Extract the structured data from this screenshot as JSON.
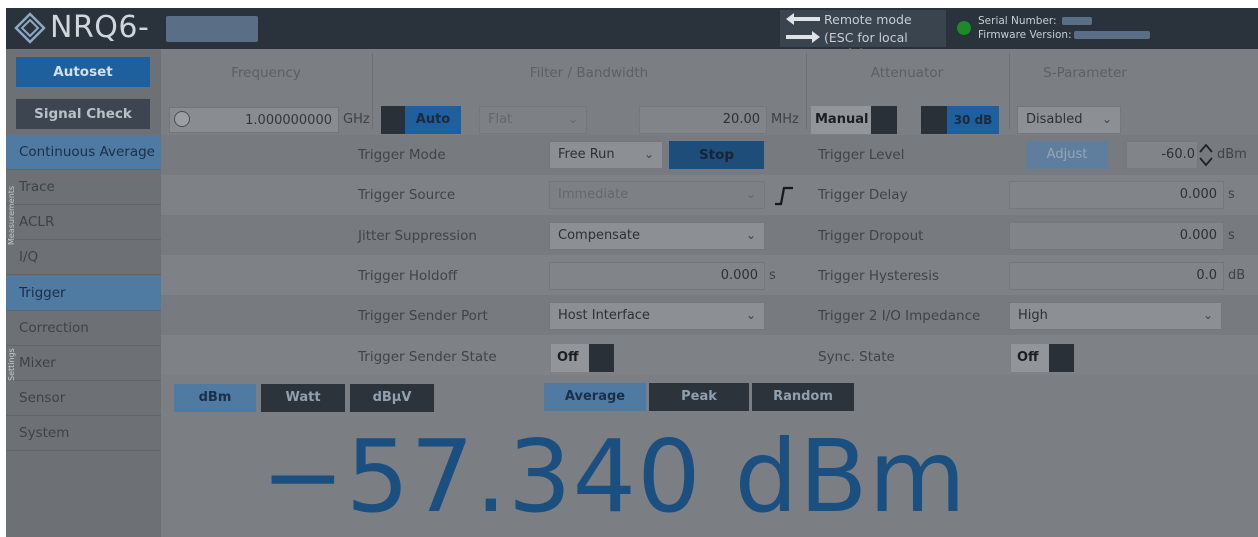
{
  "header": {
    "title": "NRQ6-",
    "remote_line1": "Remote mode",
    "remote_line2": "(ESC for local mode)",
    "serial_label": "Serial Number:",
    "firmware_label": "Firmware Version:",
    "status_color": "#1c8a2a"
  },
  "nav": {
    "autoset": "Autoset",
    "signal_check": "Signal Check",
    "group_measurements": "Measurements",
    "group_settings": "Settings",
    "items": [
      {
        "label": "Continuous Average",
        "selected": true
      },
      {
        "label": "Trace",
        "selected": false
      },
      {
        "label": "ACLR",
        "selected": false
      },
      {
        "label": "I/Q",
        "selected": false
      },
      {
        "label": "Trigger",
        "selected": true
      },
      {
        "label": "Correction",
        "selected": false
      },
      {
        "label": "Mixer",
        "selected": false
      },
      {
        "label": "Sensor",
        "selected": false
      },
      {
        "label": "System",
        "selected": false
      }
    ]
  },
  "topbar": {
    "frequency": {
      "title": "Frequency",
      "value": "1.000000000",
      "unit": "GHz"
    },
    "filter": {
      "title": "Filter / Bandwidth",
      "auto_label": "Auto",
      "filter_value": "Flat",
      "bandwidth": "20.00",
      "bandwidth_unit": "MHz"
    },
    "attenuator": {
      "title": "Attenuator",
      "mode": "Manual",
      "value": "30 dB"
    },
    "sparam": {
      "title": "S-Parameter",
      "value": "Disabled"
    }
  },
  "trigger": {
    "mode_label": "Trigger Mode",
    "mode_value": "Free Run",
    "stop_label": "Stop",
    "source_label": "Trigger Source",
    "source_value": "Immediate",
    "jitter_label": "Jitter Suppression",
    "jitter_value": "Compensate",
    "holdoff_label": "Trigger Holdoff",
    "holdoff_value": "0.000",
    "holdoff_unit": "s",
    "sender_port_label": "Trigger Sender Port",
    "sender_port_value": "Host Interface",
    "sender_state_label": "Trigger Sender State",
    "sender_state_value": "Off",
    "level_label": "Trigger Level",
    "adjust_label": "Adjust",
    "level_value": "-60.0",
    "level_unit": "dBm",
    "delay_label": "Trigger Delay",
    "delay_value": "0.000",
    "delay_unit": "s",
    "dropout_label": "Trigger Dropout",
    "dropout_value": "0.000",
    "dropout_unit": "s",
    "hysteresis_label": "Trigger Hysteresis",
    "hysteresis_value": "0.0",
    "hysteresis_unit": "dB",
    "impedance_label": "Trigger 2 I/O Impedance",
    "impedance_value": "High",
    "sync_label": "Sync. State",
    "sync_value": "Off"
  },
  "units": {
    "dbm": "dBm",
    "watt": "Watt",
    "dbuv": "dBµV",
    "selected": "dBm"
  },
  "modes": {
    "average": "Average",
    "peak": "Peak",
    "random": "Random",
    "selected": "Average"
  },
  "reading": "−57.340 dBm"
}
